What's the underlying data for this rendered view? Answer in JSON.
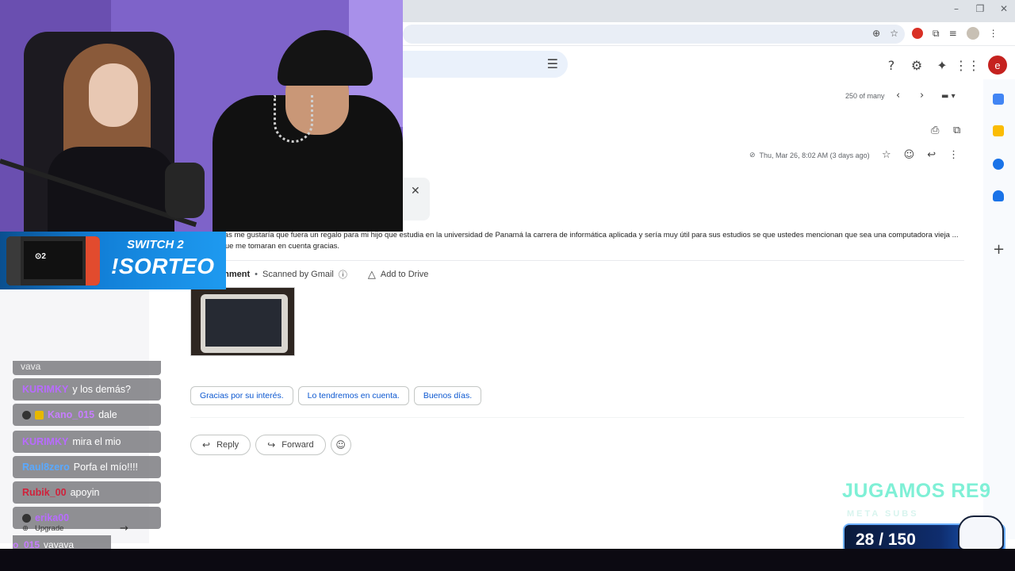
{
  "window_controls": {
    "minimize": "–",
    "restore": "❐",
    "close": "✕"
  },
  "omnibox": {
    "zoom_icon": "⊕",
    "bookmark_icon": "☆"
  },
  "extensions": {
    "puzzle_icon": "⧉",
    "playlist_icon": "≡",
    "menu_icon": "⋮"
  },
  "gmail_header": {
    "search_options_icon": "☰",
    "help_icon": "?",
    "settings_icon": "⚙",
    "gemini_icon": "✦",
    "apps_icon": "⋮⋮",
    "account_initial": "e"
  },
  "pager": {
    "text": "250 of many",
    "prev": "‹",
    "next": "›",
    "input_tool": "▬ ▾"
  },
  "message": {
    "print_icon": "⎙",
    "open_new_window_icon": "⧉",
    "date": "Thu, Mar 26, 8:02 AM (3 days ago)",
    "attachment_icon": "⊘",
    "star_icon": "☆",
    "emoji_icon": "☺",
    "reply_icon": "↩",
    "more_icon": "⋮",
    "popup_close": "✕",
    "body": "Buenos días me gustaría que fuera un regalo para mi hijo que estudia en la universidad de Panamá la carrera de informática aplicada y sería muy útil para sus estudios se que ustedes mencionan que sea una computadora vieja ... fabuloso que me tomaran en cuenta gracias."
  },
  "attachment": {
    "label": "chment",
    "dot": "•",
    "scanned": "Scanned by Gmail",
    "info_icon": "ⓘ",
    "drive_icon": "△",
    "add_to_drive": "Add to Drive"
  },
  "smart_replies": [
    "Gracias por su interés.",
    "Lo tendremos en cuenta.",
    "Buenos días."
  ],
  "actions": {
    "reply_icon": "↩",
    "reply": "Reply",
    "forward_icon": "↪",
    "forward": "Forward",
    "emoji_icon": "☺"
  },
  "promo": {
    "console_logo": "⊙2",
    "title": "SWITCH 2",
    "subtitle": "!SORTEO"
  },
  "chat": {
    "partial_top": "vava",
    "messages": [
      {
        "user": "KURIMKY",
        "text": "y los demás?",
        "user_color": "#b86bff"
      },
      {
        "user": "Kano_015",
        "text": "dale",
        "user_color": "#c77dff"
      },
      {
        "user": "KURIMKY",
        "text": "mira el mio",
        "user_color": "#b86bff"
      },
      {
        "user": "Raul8zero",
        "text": "Porfa el mío!!!!",
        "user_color": "#5aa9ff"
      },
      {
        "user": "Rubik_00",
        "text": "apoyin",
        "user_color": "#d0213b"
      },
      {
        "user": "erika00",
        "text": "",
        "user_color": "#b86bff"
      }
    ],
    "upgrade_icon": "⊕",
    "upgrade": "Upgrade",
    "arrow": "→",
    "last_user": "o_015",
    "last_text": "vavava"
  },
  "goal": {
    "title": "JUGAMOS RE9",
    "subtitle": "META SUBS",
    "counter": "28 / 150",
    "current": 28,
    "target": 150
  },
  "colors": {
    "gmail_blue": "#0b57d0",
    "chip_border": "#c4c7c5",
    "account_red": "#c5221f",
    "counter_accent": "#7ff0d6"
  }
}
